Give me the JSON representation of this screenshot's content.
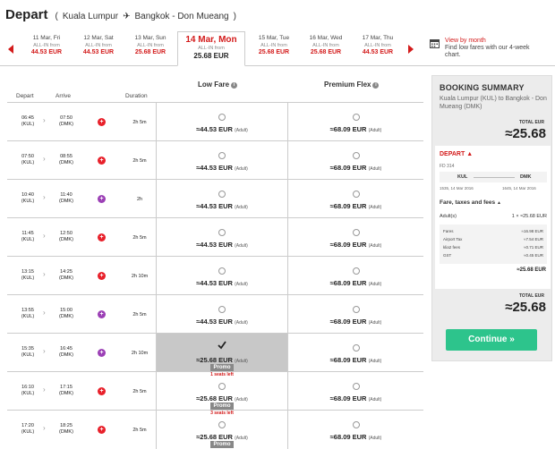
{
  "header": {
    "title": "Depart",
    "origin": "Kuala Lumpur",
    "destination": "Bangkok - Don Mueang"
  },
  "dates": [
    {
      "day": "11 Mar, Fri",
      "allin": "ALL-IN from",
      "price": "44.53 EUR",
      "selected": false
    },
    {
      "day": "12 Mar, Sat",
      "allin": "ALL-IN from",
      "price": "44.53 EUR",
      "selected": false
    },
    {
      "day": "13 Mar, Sun",
      "allin": "ALL-IN from",
      "price": "25.68 EUR",
      "selected": false
    },
    {
      "day": "14 Mar, Mon",
      "allin": "ALL-IN from",
      "price": "25.68 EUR",
      "selected": true
    },
    {
      "day": "15 Mar, Tue",
      "allin": "ALL-IN from",
      "price": "25.68 EUR",
      "selected": false
    },
    {
      "day": "16 Mar, Wed",
      "allin": "ALL-IN from",
      "price": "25.68 EUR",
      "selected": false
    },
    {
      "day": "17 Mar, Thu",
      "allin": "ALL-IN from",
      "price": "44.53 EUR",
      "selected": false
    }
  ],
  "view_by_month": {
    "link": "View by month",
    "desc": "Find low fares with our 4-week chart."
  },
  "fare_headers": {
    "low": "Low Fare",
    "flex": "Premium Flex",
    "info": "i"
  },
  "columns": {
    "depart": "Depart",
    "arrive": "Arrive",
    "duration": "Duration"
  },
  "flights": [
    {
      "dep": "06:45",
      "dep_code": "(KUL)",
      "arr": "07:50",
      "arr_code": "(DMK)",
      "carrier": "red",
      "dur": "2h 5m",
      "low": "≈44.53 EUR",
      "flex": "≈68.09 EUR",
      "promo": "",
      "seats": "",
      "highlight": false
    },
    {
      "dep": "07:50",
      "dep_code": "(KUL)",
      "arr": "08:55",
      "arr_code": "(DMK)",
      "carrier": "red",
      "dur": "2h 5m",
      "low": "≈44.53 EUR",
      "flex": "≈68.09 EUR",
      "promo": "",
      "seats": "",
      "highlight": false
    },
    {
      "dep": "10:40",
      "dep_code": "(KUL)",
      "arr": "11:40",
      "arr_code": "(DMK)",
      "carrier": "purple",
      "dur": "2h",
      "low": "≈44.53 EUR",
      "flex": "≈68.09 EUR",
      "promo": "",
      "seats": "",
      "highlight": false
    },
    {
      "dep": "11:45",
      "dep_code": "(KUL)",
      "arr": "12:50",
      "arr_code": "(DMK)",
      "carrier": "red",
      "dur": "2h 5m",
      "low": "≈44.53 EUR",
      "flex": "≈68.09 EUR",
      "promo": "",
      "seats": "",
      "highlight": false
    },
    {
      "dep": "13:15",
      "dep_code": "(KUL)",
      "arr": "14:25",
      "arr_code": "(DMK)",
      "carrier": "red",
      "dur": "2h 10m",
      "low": "≈44.53 EUR",
      "flex": "≈68.09 EUR",
      "promo": "",
      "seats": "",
      "highlight": false
    },
    {
      "dep": "13:55",
      "dep_code": "(KUL)",
      "arr": "15:00",
      "arr_code": "(DMK)",
      "carrier": "purple",
      "dur": "2h 5m",
      "low": "≈44.53 EUR",
      "flex": "≈68.09 EUR",
      "promo": "",
      "seats": "",
      "highlight": false
    },
    {
      "dep": "15:35",
      "dep_code": "(KUL)",
      "arr": "16:45",
      "arr_code": "(DMK)",
      "carrier": "purple",
      "dur": "2h 10m",
      "low": "≈25.68 EUR",
      "flex": "≈68.09 EUR",
      "promo": "Promo",
      "seats": "1 seats left",
      "highlight": true
    },
    {
      "dep": "16:10",
      "dep_code": "(KUL)",
      "arr": "17:15",
      "arr_code": "(DMK)",
      "carrier": "red",
      "dur": "2h 5m",
      "low": "≈25.68 EUR",
      "flex": "≈68.09 EUR",
      "promo": "Promo",
      "seats": "3 seats left",
      "highlight": false
    },
    {
      "dep": "17:20",
      "dep_code": "(KUL)",
      "arr": "18:25",
      "arr_code": "(DMK)",
      "carrier": "red",
      "dur": "2h 5m",
      "low": "≈25.68 EUR",
      "flex": "≈68.09 EUR",
      "promo": "Promo",
      "seats": "",
      "highlight": false
    }
  ],
  "adult_label": "(Adult)",
  "summary": {
    "title": "BOOKING SUMMARY",
    "route": "Kuala Lumpur (KUL) to Bangkok - Don Mueang (DMK)",
    "total_label": "TOTAL EUR",
    "total": "≈25.68",
    "depart": "DEPART",
    "flight_no": "FD 314",
    "from": "KUL",
    "to": "DMK",
    "dep_time": "1535, 14 Mar 2016",
    "arr_time": "1645, 14 Mar 2016",
    "fare_taxes": "Fare, taxes and fees",
    "adults_label": "Adult(s)",
    "adults_value": "1 × ≈25.68 EUR",
    "fees": [
      {
        "name": "Fares",
        "value": "≈16.98 EUR"
      },
      {
        "name": "Airport Tax",
        "value": "≈7.54 EUR"
      },
      {
        "name": "klia2 fees",
        "value": "≈0.71 EUR"
      },
      {
        "name": "GST",
        "value": "≈0.45 EUR"
      }
    ],
    "subtotal": "≈25.68 EUR"
  },
  "continue_label": "Continue »",
  "colors": {
    "brand_red": "#d31b1b",
    "carrier_red": "#e8202a",
    "carrier_purple": "#9b3fb5",
    "cta_green": "#2dc48c"
  }
}
